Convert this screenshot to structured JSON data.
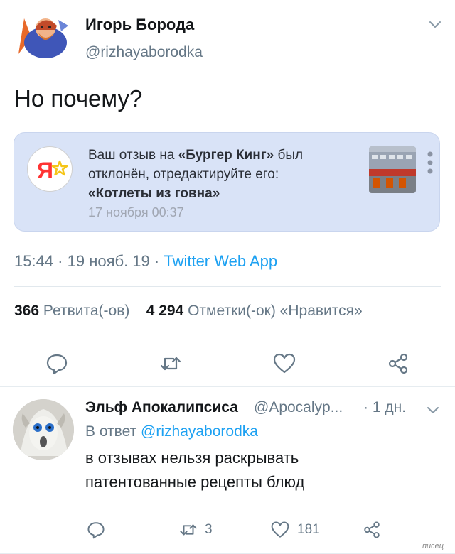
{
  "tweet": {
    "author_name": "Игорь Борода",
    "author_handle": "@rizhayaborodka",
    "text": "Но почему?",
    "time": "15:44 · 19 нояб. 19 · ",
    "source": "Twitter Web App",
    "retweets_count": "366",
    "retweets_label": "Ретвита(-ов)",
    "likes_count": "4 294",
    "likes_label": "Отметки(-ок) «Нравится»"
  },
  "notification": {
    "line1_prefix": "Ваш отзыв на ",
    "line1_bold": "«Бургер Кинг»",
    "line1_suffix": " был",
    "line2": "отклонён, отредактируйте его:",
    "line3_bold": "«Котлеты из говна»",
    "time": "17 ноября 00:37",
    "logo_text": "Я"
  },
  "reply": {
    "author_name": "Эльф Апокалипсиса",
    "author_handle": "@Apocalyp...",
    "time": "· 1 дн.",
    "reply_to_label": "В ответ",
    "reply_to_handle": "@rizhayaborodka",
    "text_line1": "в отзывах нельзя раскрывать",
    "text_line2": "патентованные рецепты блюд",
    "retweets": "3",
    "likes": "181"
  },
  "watermark": "писец",
  "colors": {
    "accent": "#1da1f2",
    "secondary_text": "#657786",
    "card_bg": "#d9e3f7"
  },
  "icons": [
    "chevron-down-icon",
    "reply-icon",
    "retweet-icon",
    "like-icon",
    "share-icon",
    "kebab-menu-icon",
    "yandex-logo"
  ]
}
